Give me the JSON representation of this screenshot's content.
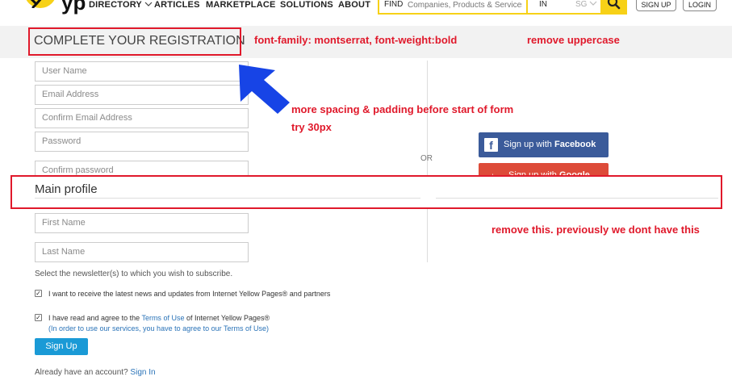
{
  "nav": {
    "logo_text": "yp",
    "items": [
      "DIRECTORY",
      "ARTICLES",
      "MARKETPLACE",
      "SOLUTIONS",
      "ABOUT"
    ],
    "find_label": "FIND",
    "find_placeholder": "Companies, Products & Services",
    "location_label": "IN",
    "location_value": "SG",
    "signup_label": "SIGN UP",
    "login_label": "LOGIN"
  },
  "registration": {
    "title": "COMPLETE YOUR REGISTRATION",
    "fields": [
      "User Name",
      "Email Address",
      "Confirm Email Address",
      "Password",
      "Confirm password"
    ],
    "or_text": "OR",
    "facebook": {
      "prefix": "Sign up with ",
      "brand": "Facebook"
    },
    "google": {
      "prefix": "Sign up with ",
      "brand": "Google"
    }
  },
  "profile": {
    "title": "Main profile",
    "first_name": "First Name",
    "last_name": "Last Name"
  },
  "newsletter": {
    "prompt": "Select the newsletter(s) to which you wish to subscribe.",
    "option": "I want to receive the latest news and updates from Internet Yellow Pages® and partners"
  },
  "terms": {
    "prefix": "I have read and agree to the ",
    "link": "Terms of Use",
    "suffix": " of Internet Yellow Pages®",
    "note": "(In order to use our services, you have to agree to our Terms of Use)"
  },
  "signup_button": "Sign Up",
  "signin": {
    "prefix": "Already have an account? ",
    "link": "Sign In"
  },
  "annotations": {
    "font_note": "font-family: montserrat, font-weight:bold",
    "uppercase_note": "remove uppercase",
    "spacing_note_1": "more spacing & padding before start of form",
    "spacing_note_2": "try 30px",
    "remove_note": "remove this. previously we dont have this"
  },
  "colors": {
    "brand_yellow": "#f7d117",
    "annotation_red": "#e0192b",
    "arrow_blue": "#1744e6",
    "facebook_blue": "#3b5b9a",
    "google_red": "#dd4b39",
    "button_blue": "#1a9ad6",
    "link_blue": "#2a73b8"
  }
}
